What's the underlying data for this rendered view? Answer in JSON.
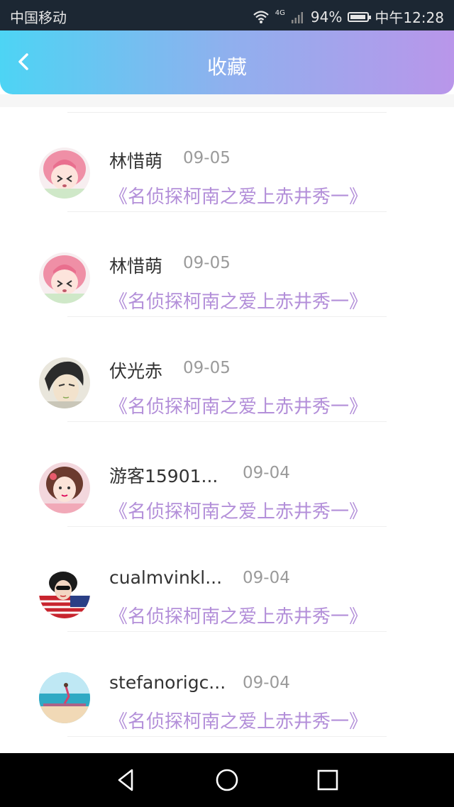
{
  "status_bar": {
    "carrier": "中国移动",
    "network": "4G",
    "battery": "94%",
    "battery_level": 0.94,
    "time": "中午12:28"
  },
  "header": {
    "title": "收藏",
    "back_icon": "chevron-left-icon"
  },
  "colors": {
    "header_gradient": [
      "#4dd4f4",
      "#b996ea"
    ],
    "name": "#333333",
    "date": "#9a9a9a",
    "work_title": "#b38fd9"
  },
  "favorites": [
    {
      "name": "林惜萌",
      "date": "09-05",
      "work": "《名侦探柯南之爱上赤井秀一》",
      "avatar": "anime-girl-pink-hair"
    },
    {
      "name": "林惜萌",
      "date": "09-05",
      "work": "《名侦探柯南之爱上赤井秀一》",
      "avatar": "anime-girl-pink-hair"
    },
    {
      "name": "伏光赤",
      "date": "09-05",
      "work": "《名侦探柯南之爱上赤井秀一》",
      "avatar": "anime-man-dark-hair"
    },
    {
      "name": "游客15901...",
      "date": "09-04",
      "work": "《名侦探柯南之爱上赤井秀一》",
      "avatar": "girl-photo"
    },
    {
      "name": "cualmvinkl...",
      "date": "09-04",
      "work": "《名侦探柯南之爱上赤井秀一》",
      "avatar": "girl-sunglasses-flag"
    },
    {
      "name": "stefanorigc...",
      "date": "09-04",
      "work": "《名侦探柯南之爱上赤井秀一》",
      "avatar": "beach-photo"
    }
  ],
  "nav_bar": {
    "back": "triangle-back-icon",
    "home": "circle-home-icon",
    "recent": "square-recent-icon"
  }
}
